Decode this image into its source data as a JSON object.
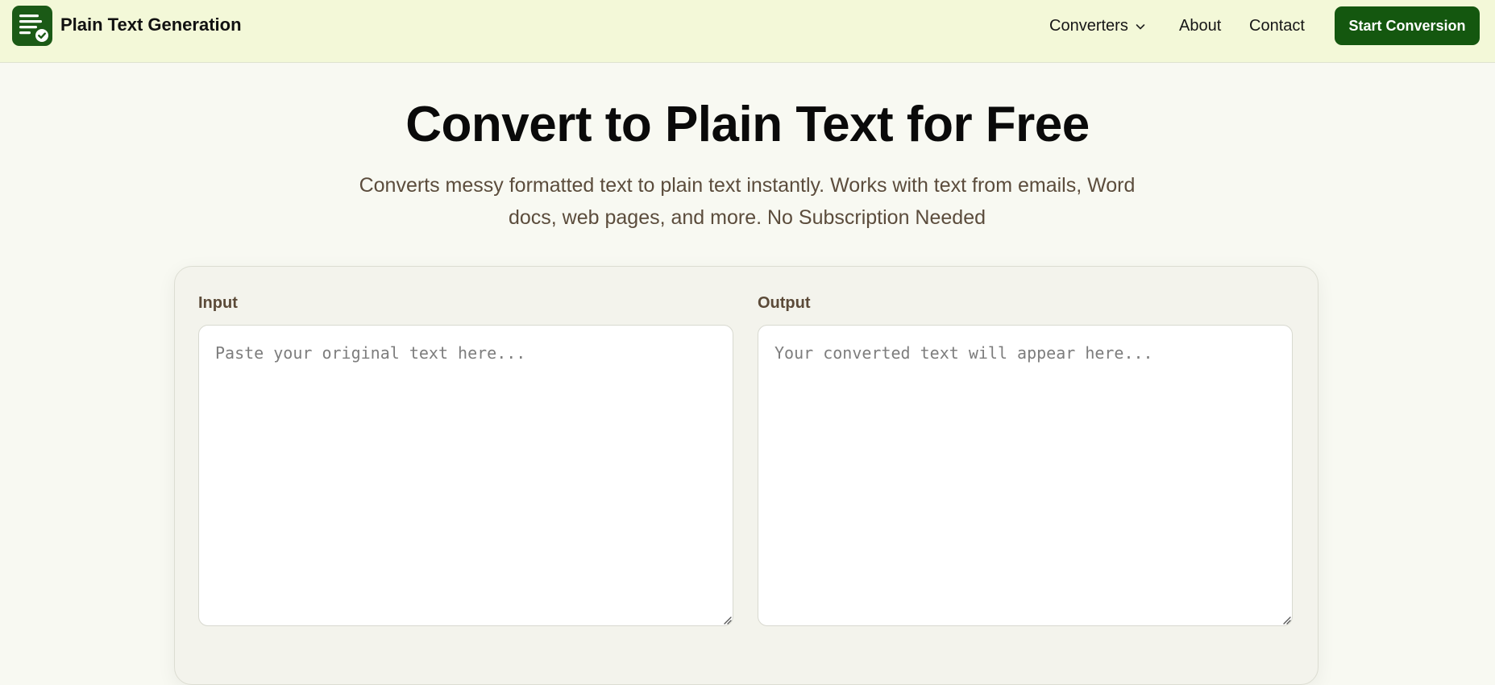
{
  "header": {
    "brand": "Plain Text Generation",
    "logo_icon": "text-check-icon",
    "nav": {
      "converters": "Converters",
      "about": "About",
      "contact": "Contact"
    },
    "cta_label": "Start Conversion"
  },
  "hero": {
    "title": "Convert to Plain Text for Free",
    "subtitle": "Converts messy formatted text to plain text instantly. Works with text from emails, Word docs, web pages, and more. No Subscription Needed"
  },
  "converter": {
    "input": {
      "label": "Input",
      "placeholder": "Paste your original text here...",
      "value": ""
    },
    "output": {
      "label": "Output",
      "placeholder": "Your converted text will appear here...",
      "value": ""
    }
  },
  "colors": {
    "header_bg": "#f3f8d8",
    "page_bg": "#f8f9f2",
    "brand_green": "#14570f",
    "label_brown": "#5b4a38"
  }
}
